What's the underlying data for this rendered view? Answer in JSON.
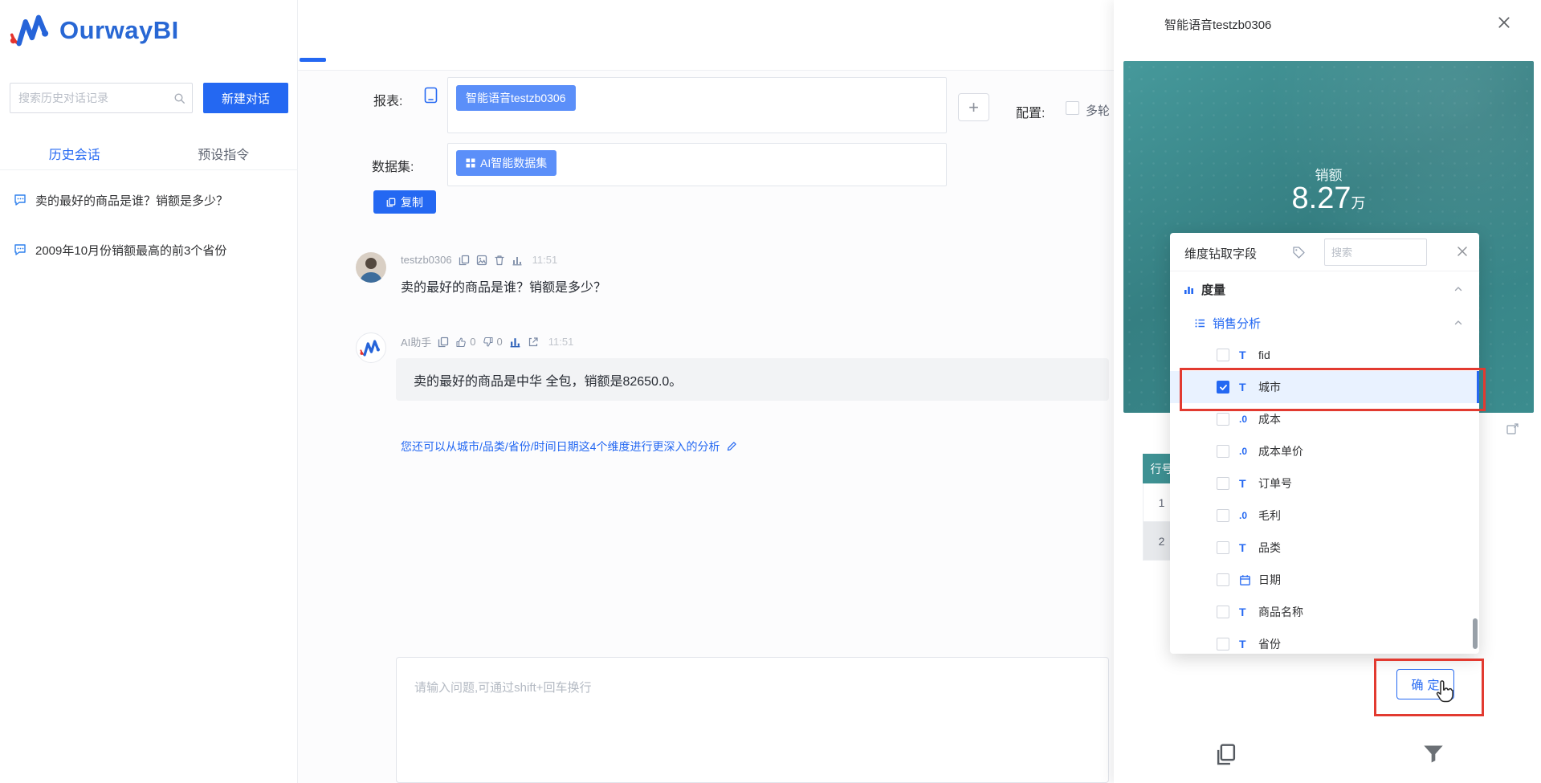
{
  "brand": {
    "name": "OurwayBI"
  },
  "colors": {
    "primary": "#2468F2",
    "tag_blue": "#5B8FF9",
    "teal": "#37898B",
    "annotation_red": "#E23A30"
  },
  "sidebar": {
    "search_placeholder": "搜索历史对话记录",
    "new_chat_button": "新建对话",
    "tabs": {
      "history": "历史会话",
      "preset": "预设指令"
    },
    "history_items": [
      "卖的最好的商品是谁？销额是多少？",
      "2009年10月份销额最高的前3个省份"
    ]
  },
  "toolbar": {
    "report_label": "报表:",
    "report_tag": "智能语音testzb0306",
    "add_button": "+",
    "config_label": "配置:",
    "config_option": "多轮",
    "dataset_label": "数据集:",
    "dataset_tag": "AI智能数据集",
    "copy_button": "复制"
  },
  "chat": {
    "user": {
      "name": "testzb0306",
      "time": "11:51",
      "message": "卖的最好的商品是谁？销额是多少？"
    },
    "ai": {
      "name": "AI助手",
      "like_count": "0",
      "dislike_count": "0",
      "time": "11:51",
      "message": "卖的最好的商品是中华 全包，销额是82650.0。",
      "suggestion": "您还可以从城市/品类/省份/时间日期这4个维度进行更深入的分析"
    },
    "input_placeholder": "请输入问题,可通过shift+回车换行"
  },
  "panel": {
    "title": "智能语音testzb0306",
    "kpi": {
      "label": "销额",
      "value": "8.27",
      "unit": "万"
    },
    "table": {
      "header": "行号",
      "rows": [
        "1",
        "2"
      ]
    },
    "drilldown": {
      "title": "维度钻取字段",
      "search_placeholder": "搜索",
      "group": "度量",
      "subgroup": "销售分析",
      "fields": [
        {
          "glyph": "T",
          "name": "fid",
          "checked": false
        },
        {
          "glyph": "T",
          "name": "城市",
          "checked": true
        },
        {
          "glyph": ".0",
          "name": "成本",
          "checked": false
        },
        {
          "glyph": ".0",
          "name": "成本单价",
          "checked": false
        },
        {
          "glyph": "T",
          "name": "订单号",
          "checked": false
        },
        {
          "glyph": ".0",
          "name": "毛利",
          "checked": false
        },
        {
          "glyph": "T",
          "name": "品类",
          "checked": false
        },
        {
          "glyph": "",
          "icon": "calendar-icon",
          "name": "日期",
          "checked": false
        },
        {
          "glyph": "T",
          "name": "商品名称",
          "checked": false
        },
        {
          "glyph": "T",
          "name": "省份",
          "checked": false
        }
      ],
      "confirm_button": "确定"
    }
  }
}
